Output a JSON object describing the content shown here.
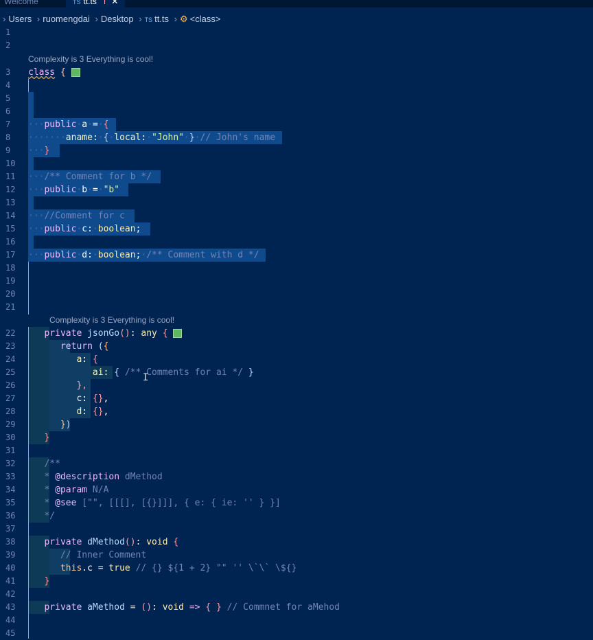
{
  "tabs": [
    {
      "label": "Welcome",
      "active": false
    },
    {
      "label": "tt.ts",
      "active": true,
      "icon": "TS",
      "modified": "I"
    }
  ],
  "breadcrumb": {
    "items": [
      "Users",
      "ruomengdai",
      "Desktop"
    ],
    "file_icon": "TS",
    "file": "tt.ts",
    "symbol": "<class>"
  },
  "codelens": {
    "class_lens": "Complexity is 3 Everything is cool!",
    "method_lens": "Complexity is 3 Everything is cool!"
  },
  "line_numbers": [
    "1",
    "2",
    "3",
    "4",
    "5",
    "6",
    "7",
    "8",
    "9",
    "10",
    "11",
    "12",
    "13",
    "14",
    "15",
    "16",
    "17",
    "18",
    "19",
    "20",
    "21",
    "22",
    "23",
    "24",
    "25",
    "26",
    "27",
    "28",
    "29",
    "30",
    "31",
    "32",
    "33",
    "34",
    "35",
    "36",
    "37",
    "38",
    "39",
    "40",
    "41",
    "42",
    "43",
    "44",
    "45"
  ],
  "code": {
    "l3_kw": "class",
    "l3_brace": "{",
    "l7": [
      "public",
      "a",
      "=",
      "{"
    ],
    "l8": [
      "aname",
      ":",
      "{",
      "local",
      ":",
      "\"John\"",
      "}",
      "// John's name"
    ],
    "l9": "}",
    "l11": "/** Comment for b */",
    "l12": [
      "public",
      "b",
      "=",
      "\"b\""
    ],
    "l14": "//Comment for c",
    "l15": [
      "public",
      "c",
      ":",
      "boolean",
      ";"
    ],
    "l17": [
      "public",
      "d",
      ":",
      "boolean",
      ";",
      "/** Comment with d */"
    ],
    "l22": [
      "private",
      "jsonGo",
      "()",
      ":",
      "any",
      "{"
    ],
    "l23": [
      "return",
      "(",
      "{"
    ],
    "l24": [
      "a",
      ":",
      "{"
    ],
    "l25": [
      "ai",
      ":",
      "{",
      "/** Comments for ai */",
      "}"
    ],
    "l26": "},",
    "l27": [
      "c",
      ":",
      "{}",
      ","
    ],
    "l28": [
      "d",
      ":",
      "{}",
      ","
    ],
    "l29": [
      "}",
      ")"
    ],
    "l30": "}",
    "l32": "/**",
    "l33": [
      "* ",
      "@description",
      " dMethod"
    ],
    "l34": [
      "* ",
      "@param",
      " N/A"
    ],
    "l35": [
      "* ",
      "@see",
      " [\"\", [[[], [{}]]], { e: { ie: '' } }]"
    ],
    "l36": "*/",
    "l38": [
      "private",
      "dMethod",
      "()",
      ":",
      "void",
      "{"
    ],
    "l39": "// Inner Comment",
    "l40": [
      "this",
      ".c",
      "=",
      "true",
      "// {} ${1 + 2} \"\" '' \\`\\` \\${}"
    ],
    "l41": "}",
    "l43": [
      "private",
      "aMethod",
      "=",
      "()",
      ":",
      "void",
      "=>",
      "{",
      "}",
      "// Commnet for aMehod"
    ]
  },
  "colors": {
    "background": "#002451",
    "selection": "#0f4a8d",
    "keyword": "#ebbbff",
    "string": "#d1f1a9",
    "comment": "#7285b7",
    "type": "#ffeead"
  }
}
